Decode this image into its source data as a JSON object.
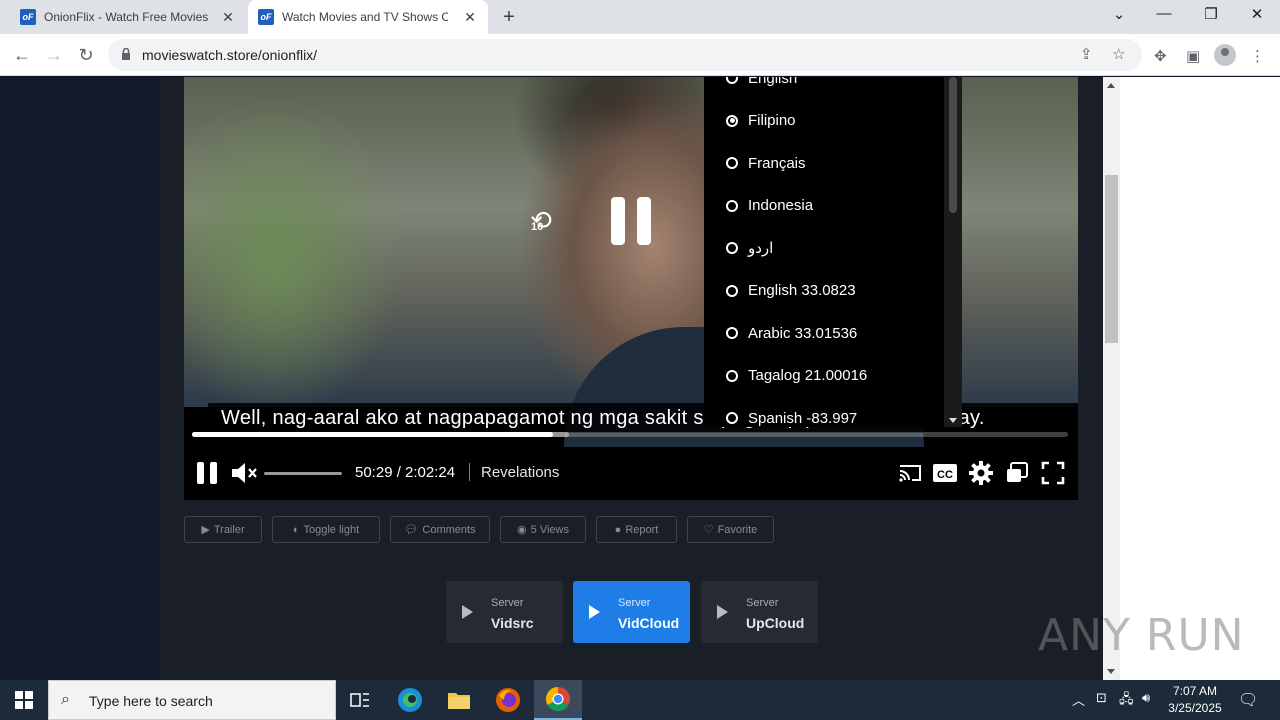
{
  "browser": {
    "tabs": [
      {
        "title": "OnionFlix - Watch Free Movies & ",
        "favicon": "oF"
      },
      {
        "title": "Watch Movies and TV Shows On",
        "favicon": "oF"
      }
    ],
    "url": "movieswatch.store/onionflix/"
  },
  "player": {
    "subtitle": "Well, nag-aaral ako at nagpapagamot ng mga sakit sa pag-hilip para sa kabubuhay.",
    "rewind_label": "10",
    "time": "50:29 / 2:02:24",
    "chapter": "Revelations",
    "progress": {
      "played_fraction": 0.412,
      "buffered_fraction": 0.43
    },
    "volume_fraction": 0.0,
    "subtitle_menu": {
      "items": [
        {
          "label": "English",
          "selected": false
        },
        {
          "label": "Filipino",
          "selected": true
        },
        {
          "label": "Français",
          "selected": false
        },
        {
          "label": "Indonesia",
          "selected": false
        },
        {
          "label": "اردو",
          "selected": false
        },
        {
          "label": "English 33.0823",
          "selected": false
        },
        {
          "label": "Arabic 33.01536",
          "selected": false
        },
        {
          "label": "Tagalog 21.00016",
          "selected": false
        },
        {
          "label": "Spanish -83.997",
          "selected": false
        }
      ]
    }
  },
  "actions": [
    {
      "label": "Trailer",
      "icon": "youtube-icon"
    },
    {
      "label": "Toggle light",
      "icon": "contrast-icon"
    },
    {
      "label": "Comments",
      "icon": "comment-icon"
    },
    {
      "label": "5 Views",
      "icon": "eye-icon"
    },
    {
      "label": "Report",
      "icon": "alert-icon"
    },
    {
      "label": "Favorite",
      "icon": "heart-icon"
    }
  ],
  "servers": [
    {
      "label": "Server",
      "name": "Vidsrc",
      "active": false
    },
    {
      "label": "Server",
      "name": "VidCloud",
      "active": true
    },
    {
      "label": "Server",
      "name": "UpCloud",
      "active": false
    }
  ],
  "watermark": "ANY RUN",
  "taskbar": {
    "search_placeholder": "Type here to search",
    "time": "7:07 AM",
    "date": "3/25/2025"
  },
  "colors": {
    "accent": "#1e7de6",
    "page_bg": "#1a1e27",
    "taskbar": "#1c2a3a"
  }
}
